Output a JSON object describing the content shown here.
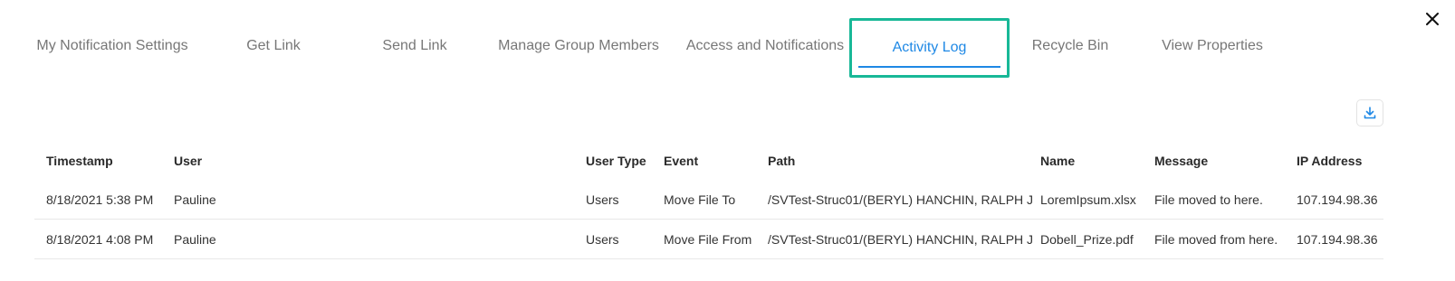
{
  "tabs": [
    {
      "label": "My Notification Settings",
      "active": false
    },
    {
      "label": "Get Link",
      "active": false
    },
    {
      "label": "Send Link",
      "active": false
    },
    {
      "label": "Manage Group Members",
      "active": false
    },
    {
      "label": "Access and Notifications",
      "active": false
    },
    {
      "label": "Activity Log",
      "active": true
    },
    {
      "label": "Recycle Bin",
      "active": false
    },
    {
      "label": "View Properties",
      "active": false
    }
  ],
  "icons": {
    "close": "close-icon",
    "download": "download-icon"
  },
  "colors": {
    "active_tab_text": "#1e88e5",
    "active_tab_border": "#18b897",
    "inactive_tab_text": "#777777"
  },
  "table": {
    "columns": [
      "Timestamp",
      "User",
      "User Type",
      "Event",
      "Path",
      "Name",
      "Message",
      "IP Address"
    ],
    "rows": [
      {
        "timestamp": "8/18/2021 5:38 PM",
        "user": "Pauline",
        "user_type": "Users",
        "event": "Move File To",
        "path": "/SVTest-Struc01/(BERYL) HANCHIN, RALPH J",
        "name": "LoremIpsum.xlsx",
        "message": "File moved to here.",
        "ip": "107.194.98.36"
      },
      {
        "timestamp": "8/18/2021 4:08 PM",
        "user": "Pauline",
        "user_type": "Users",
        "event": "Move File From",
        "path": "/SVTest-Struc01/(BERYL) HANCHIN, RALPH J",
        "name": "Dobell_Prize.pdf",
        "message": "File moved from here.",
        "ip": "107.194.98.36"
      }
    ]
  }
}
